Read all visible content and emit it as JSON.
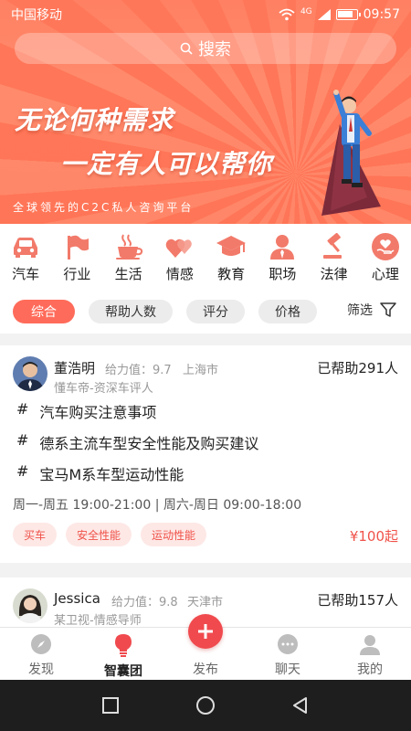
{
  "status": {
    "carrier": "中国移动",
    "signal": "4G",
    "time": "09:57"
  },
  "search": {
    "label": "搜索"
  },
  "banner": {
    "line1": "无论何种需求",
    "line2": "一定有人可以帮你",
    "tagline": "全球领先的C2C私人咨询平台"
  },
  "categories": [
    {
      "label": "汽车",
      "icon": "car-icon"
    },
    {
      "label": "行业",
      "icon": "flag-icon"
    },
    {
      "label": "生活",
      "icon": "coffee-icon"
    },
    {
      "label": "情感",
      "icon": "hearts-icon"
    },
    {
      "label": "教育",
      "icon": "graduation-cap-icon"
    },
    {
      "label": "职场",
      "icon": "person-icon"
    },
    {
      "label": "法律",
      "icon": "gavel-icon"
    },
    {
      "label": "心理",
      "icon": "heart-hand-icon"
    }
  ],
  "filters": {
    "chips": [
      "综合",
      "帮助人数",
      "评分",
      "价格"
    ],
    "active": "综合",
    "filter_label": "筛选"
  },
  "experts": [
    {
      "name": "董浩明",
      "power": "给力值：9.7",
      "city": "上海市",
      "helped": "已帮助291人",
      "title": "懂车帝-资深车评人",
      "topics": [
        "汽车购买注意事项",
        "德系主流车型安全性能及购买建议",
        "宝马M系车型运动性能"
      ],
      "hours": "周一-周五 19:00-21:00 | 周六-周日 09:00-18:00",
      "tags": [
        "买车",
        "安全性能",
        "运动性能"
      ],
      "price": "¥100起"
    },
    {
      "name": "Jessica",
      "power": "给力值：9.8",
      "city": "天津市",
      "helped": "已帮助157人",
      "title": "某卫视-情感导师"
    }
  ],
  "tabs": [
    {
      "label": "发现",
      "icon": "compass-icon"
    },
    {
      "label": "智囊团",
      "icon": "lightbulb-icon"
    },
    {
      "label": "发布",
      "icon": "plus-icon"
    },
    {
      "label": "聊天",
      "icon": "chat-icon"
    },
    {
      "label": "我的",
      "icon": "user-icon"
    }
  ],
  "active_tab": "智囊团",
  "colors": {
    "accent": "#ff6b5a",
    "price": "#f0524a",
    "icon": "#f27a6a",
    "publish": "#f04a4e"
  }
}
